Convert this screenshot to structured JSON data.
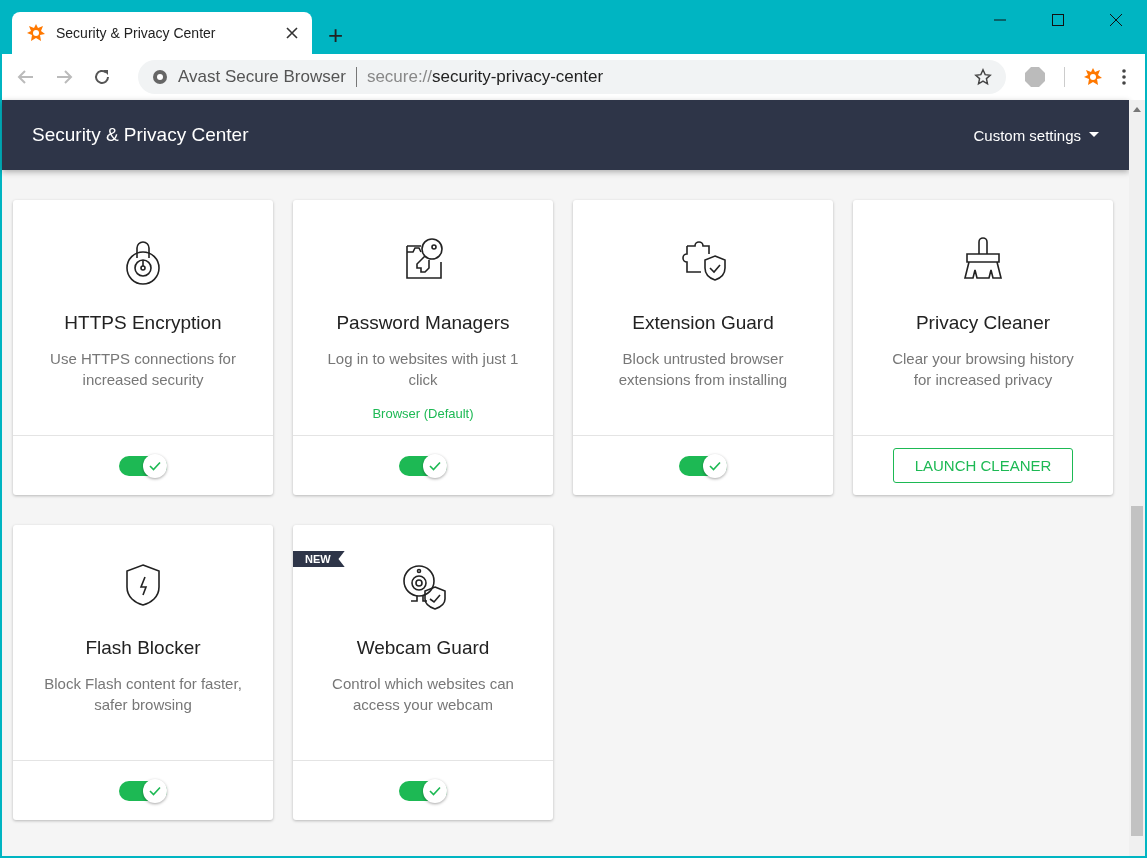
{
  "window": {
    "tab_title": "Security & Privacy Center",
    "new_tab": "+"
  },
  "address_bar": {
    "site_name": "Avast Secure Browser",
    "scheme": "secure://",
    "path": "security-privacy-center"
  },
  "header": {
    "title": "Security & Privacy Center",
    "menu": "Custom settings"
  },
  "cards": [
    {
      "kind": "lock",
      "title": "HTTPS Encryption",
      "description": "Use HTTPS connections for increased security",
      "on": true
    },
    {
      "kind": "key",
      "title": "Password Managers",
      "description": "Log in to websites with just 1 click",
      "note": "Browser (Default)",
      "on": true
    },
    {
      "kind": "puzzle",
      "title": "Extension Guard",
      "description": "Block untrusted browser extensions from installing",
      "on": true
    },
    {
      "kind": "brush",
      "title": "Privacy Cleaner",
      "description": "Clear your browsing history for increased privacy",
      "button": "LAUNCH CLEANER"
    },
    {
      "kind": "flash",
      "title": "Flash Blocker",
      "description": "Block Flash content for faster, safer browsing",
      "on": true
    },
    {
      "kind": "webcam",
      "badge": "NEW",
      "title": "Webcam Guard",
      "description": "Control which websites can access your webcam",
      "on": true
    }
  ]
}
